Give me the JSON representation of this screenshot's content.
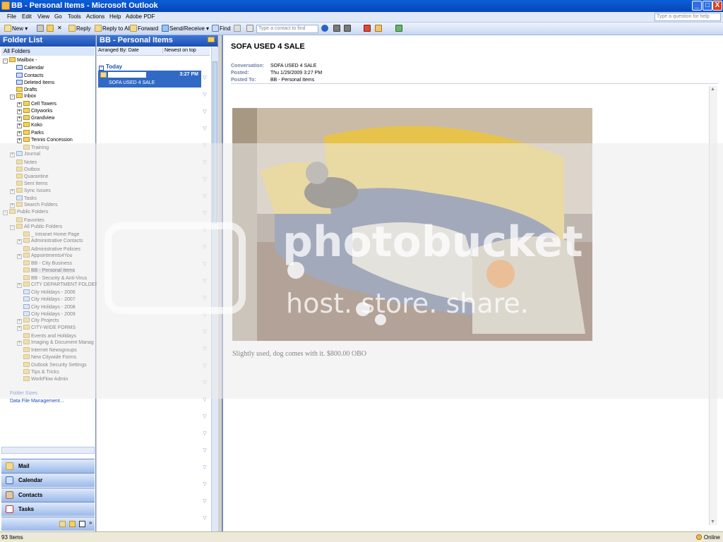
{
  "window": {
    "title": "BB - Personal Items - Microsoft Outlook",
    "min": "_",
    "max": "□",
    "close": "X"
  },
  "menu": {
    "items": [
      "File",
      "Edit",
      "View",
      "Go",
      "Tools",
      "Actions",
      "Help",
      "Adobe PDF"
    ],
    "help_placeholder": "Type a question for help"
  },
  "toolbar": {
    "new": "New",
    "reply": "Reply",
    "reply_all": "Reply to All",
    "forward": "Forward",
    "send_receive": "Send/Receive",
    "find": "Find",
    "contact_placeholder": "Type a contact to find"
  },
  "folder_pane": {
    "title": "Folder List",
    "all_folders": "All Folders",
    "tree": [
      {
        "label": "Mailbox -",
        "type": "folder",
        "depth": 0,
        "exp": "-"
      },
      {
        "label": "Calendar",
        "type": "cal",
        "depth": 1
      },
      {
        "label": "Contacts",
        "type": "cal",
        "depth": 1
      },
      {
        "label": "Deleted Items",
        "type": "cal",
        "depth": 1
      },
      {
        "label": "Drafts",
        "type": "folder",
        "depth": 1
      },
      {
        "label": "Inbox",
        "type": "folder",
        "depth": 1,
        "exp": "-"
      },
      {
        "label": "Cell Towers",
        "type": "folder",
        "depth": 2,
        "exp": "+"
      },
      {
        "label": "Cityworks",
        "type": "folder",
        "depth": 2,
        "exp": "+"
      },
      {
        "label": "Grandview",
        "type": "folder",
        "depth": 2,
        "exp": "+"
      },
      {
        "label": "Koko",
        "type": "folder",
        "depth": 2,
        "exp": "+"
      },
      {
        "label": "Parks",
        "type": "folder",
        "depth": 2,
        "exp": "+"
      },
      {
        "label": "Tennis Concession",
        "type": "folder",
        "depth": 2,
        "exp": "+"
      },
      {
        "label": "Training",
        "type": "folder",
        "depth": 2
      },
      {
        "label": "Journal",
        "type": "cal",
        "depth": 1,
        "exp": "+"
      },
      {
        "label": "Notes",
        "type": "folder",
        "depth": 1
      },
      {
        "label": "Outbox",
        "type": "folder",
        "depth": 1
      },
      {
        "label": "Quarantine",
        "type": "folder",
        "depth": 1
      },
      {
        "label": "Sent Items",
        "type": "folder",
        "depth": 1
      },
      {
        "label": "Sync Issues",
        "type": "folder",
        "depth": 1,
        "exp": "+"
      },
      {
        "label": "Tasks",
        "type": "cal",
        "depth": 1
      },
      {
        "label": "Search Folders",
        "type": "folder",
        "depth": 1,
        "exp": "+"
      },
      {
        "label": "Public Folders",
        "type": "folder",
        "depth": 0,
        "exp": "-"
      },
      {
        "label": "Favorites",
        "type": "folder",
        "depth": 1
      },
      {
        "label": "All Public Folders",
        "type": "folder",
        "depth": 1,
        "exp": "-"
      },
      {
        "label": "_ Intranet Home Page",
        "type": "folder",
        "depth": 2
      },
      {
        "label": "Administrative Contacts",
        "type": "folder",
        "depth": 2,
        "exp": "+"
      },
      {
        "label": "Administrative Policies",
        "type": "folder",
        "depth": 2
      },
      {
        "label": "Appointments4You",
        "type": "folder",
        "depth": 2,
        "exp": "+"
      },
      {
        "label": "BB - City Business",
        "type": "folder",
        "depth": 2
      },
      {
        "label": "BB - Personal Items",
        "type": "folder",
        "depth": 2,
        "selected": true
      },
      {
        "label": "BB - Security & Anti-Virus",
        "type": "folder",
        "depth": 2
      },
      {
        "label": "CITY DEPARTMENT FOLDER",
        "type": "folder",
        "depth": 2,
        "exp": "+"
      },
      {
        "label": "City Holidays - 2006",
        "type": "cal",
        "depth": 2
      },
      {
        "label": "City Holidays - 2007",
        "type": "cal",
        "depth": 2
      },
      {
        "label": "City Holidays - 2008",
        "type": "cal",
        "depth": 2
      },
      {
        "label": "City Holidays - 2009",
        "type": "cal",
        "depth": 2
      },
      {
        "label": "City Projects",
        "type": "folder",
        "depth": 2,
        "exp": "+"
      },
      {
        "label": "CITY-WIDE FORMS",
        "type": "folder",
        "depth": 2,
        "exp": "+"
      },
      {
        "label": "Events and Holidays",
        "type": "folder",
        "depth": 2
      },
      {
        "label": "Imaging & Document Manag",
        "type": "folder",
        "depth": 2,
        "exp": "+"
      },
      {
        "label": "Internet Newsgroups",
        "type": "folder",
        "depth": 2
      },
      {
        "label": "New Citywide Forms",
        "type": "folder",
        "depth": 2
      },
      {
        "label": "Outlook Security Settings",
        "type": "folder",
        "depth": 2
      },
      {
        "label": "Tips & Tricks",
        "type": "folder",
        "depth": 2
      },
      {
        "label": "WorkFlow Admin",
        "type": "folder",
        "depth": 2
      }
    ],
    "folder_sizes": "Folder Sizes",
    "data_file_mgmt": "Data File Management..."
  },
  "nav": {
    "mail": "Mail",
    "calendar": "Calendar",
    "contacts": "Contacts",
    "tasks": "Tasks"
  },
  "message_list": {
    "title": "BB - Personal Items",
    "arranged_by": "Arranged By: Date",
    "sort": "Newest on top",
    "group": "Today",
    "items": [
      {
        "time": "3:27 PM",
        "subject": "SOFA USED 4 SALE"
      }
    ]
  },
  "reading": {
    "subject": "SOFA USED 4 SALE",
    "conversation_label": "Conversation:",
    "conversation": "SOFA USED 4 SALE",
    "posted_label": "Posted:",
    "posted": "Thu 1/29/2009 3:27 PM",
    "posted_to_label": "Posted To:",
    "posted_to": "BB - Personal Items",
    "body": "Slightly used, dog comes with it. $800.00 OBO"
  },
  "watermark": {
    "brand": "photobucket",
    "tagline": "host. store. share."
  },
  "status": {
    "items": "93 Items",
    "online": "Online"
  },
  "colors": {
    "titlebar": "#0a5fd8",
    "selection": "#316ac5",
    "pane_header": "#1c4fb0"
  }
}
